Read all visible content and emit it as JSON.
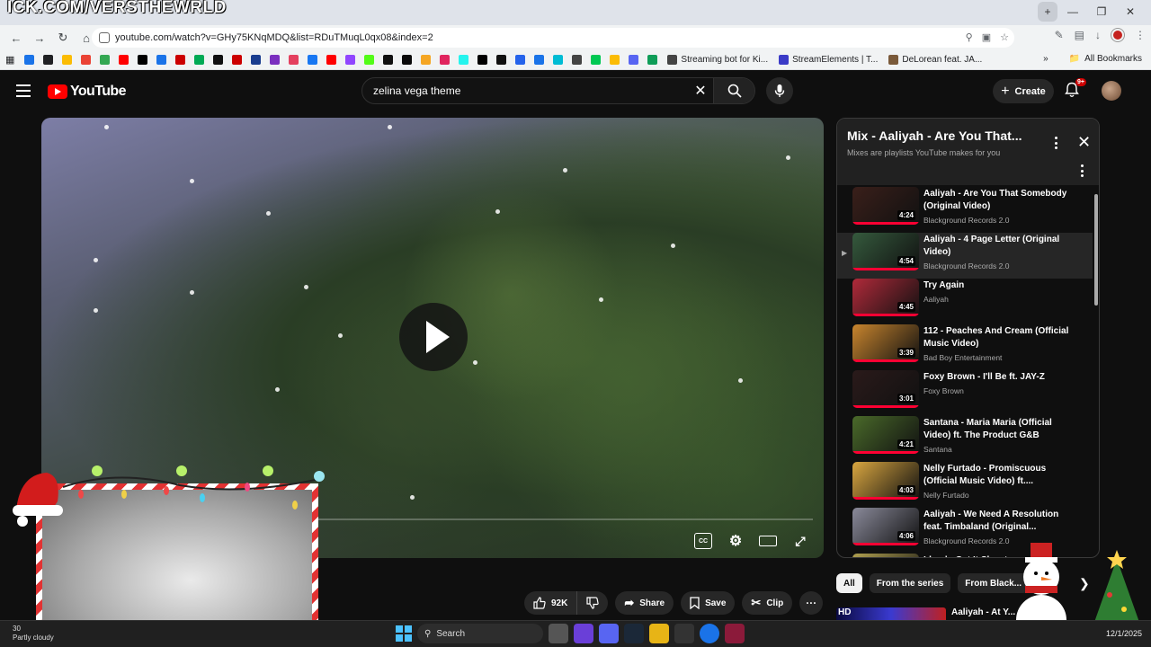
{
  "overlay": {
    "stream_text": "ICK.COM/VERSTHEWRLD"
  },
  "browser": {
    "url": "youtube.com/watch?v=GHy75KNqMDQ&list=RDuTMuqL0qx08&index=2",
    "bookmarks": [
      {
        "label": "Streaming bot for Ki...",
        "icon": "streaming-bot-icon"
      },
      {
        "label": "StreamElements | T...",
        "icon": "streamelements-icon"
      },
      {
        "label": "DeLorean feat. JA...",
        "icon": "delorean-icon"
      }
    ],
    "all_bookmarks": "All Bookmarks",
    "bookmark_icon_colors": [
      "#1a73e8",
      "#202124",
      "#fbbc04",
      "#ea4335",
      "#34a853",
      "#ff0000",
      "#000000",
      "#1a73e8",
      "#cc0000",
      "#00aa55",
      "#111111",
      "#cc0000",
      "#1a3d8f",
      "#7a2fbf",
      "#e4405f",
      "#1877f2",
      "#ff0000",
      "#9146ff",
      "#53fc18",
      "#111111",
      "#0a0a0a",
      "#f5a623",
      "#e0245e",
      "#25f4ee",
      "#000000",
      "#111111",
      "#2563eb",
      "#1a73e8",
      "#00bcd4",
      "#444444",
      "#00c853",
      "#fbbc04",
      "#5865f2",
      "#0f9d58"
    ]
  },
  "youtube": {
    "logo_text": "YouTube",
    "search_value": "zelina vega theme",
    "create_label": "Create",
    "notification_count": "9+"
  },
  "video": {
    "controls": [
      "cc-button",
      "settings-button",
      "theater-button",
      "fullscreen-button"
    ]
  },
  "playlist": {
    "title": "Mix - Aaliyah - Are You That...",
    "subtitle": "Mixes are playlists YouTube makes for you",
    "items": [
      {
        "title": "Aaliyah - Are You That Somebody (Original Video)",
        "channel": "Blackground Records 2.0",
        "duration": "4:24",
        "thumb": "#3a1f1a",
        "active": false
      },
      {
        "title": "Aaliyah - 4 Page Letter (Original Video)",
        "channel": "Blackground Records 2.0",
        "duration": "4:54",
        "thumb": "#355a3d",
        "active": true
      },
      {
        "title": "Try Again",
        "channel": "Aaliyah",
        "duration": "4:45",
        "thumb": "#b02a3a",
        "active": false
      },
      {
        "title": "112 - Peaches And Cream (Official Music Video)",
        "channel": "Bad Boy Entertainment",
        "duration": "3:39",
        "thumb": "#c8852e",
        "active": false
      },
      {
        "title": "Foxy Brown - I'll Be ft. JAY-Z",
        "channel": "Foxy Brown",
        "duration": "3:01",
        "thumb": "#2a1a1a",
        "active": false
      },
      {
        "title": "Santana - Maria Maria (Official Video) ft. The Product G&B",
        "channel": "Santana",
        "duration": "4:21",
        "thumb": "#4a6a2a",
        "active": false
      },
      {
        "title": "Nelly Furtado - Promiscuous (Official Music Video) ft....",
        "channel": "Nelly Furtado",
        "duration": "4:03",
        "thumb": "#d9a640",
        "active": false
      },
      {
        "title": "Aaliyah - We Need A Resolution feat. Timbaland (Original...",
        "channel": "Blackground Records 2.0",
        "duration": "4:06",
        "thumb": "#8a8a9a",
        "active": false
      },
      {
        "title": "Lloyd - Get It Shawty",
        "channel": "",
        "duration": "",
        "thumb": "#b0a050",
        "active": false
      }
    ]
  },
  "chips": [
    "All",
    "From the series",
    "From Black..."
  ],
  "recommendation": {
    "badge": "HD",
    "title": "Aaliyah - At Y..."
  },
  "actions": {
    "like_count": "92K",
    "share": "Share",
    "save": "Save",
    "clip": "Clip"
  },
  "taskbar": {
    "search": "Search",
    "weather": "30",
    "weather_sub": "Partly cloudy",
    "clock": "12/1/2025"
  }
}
